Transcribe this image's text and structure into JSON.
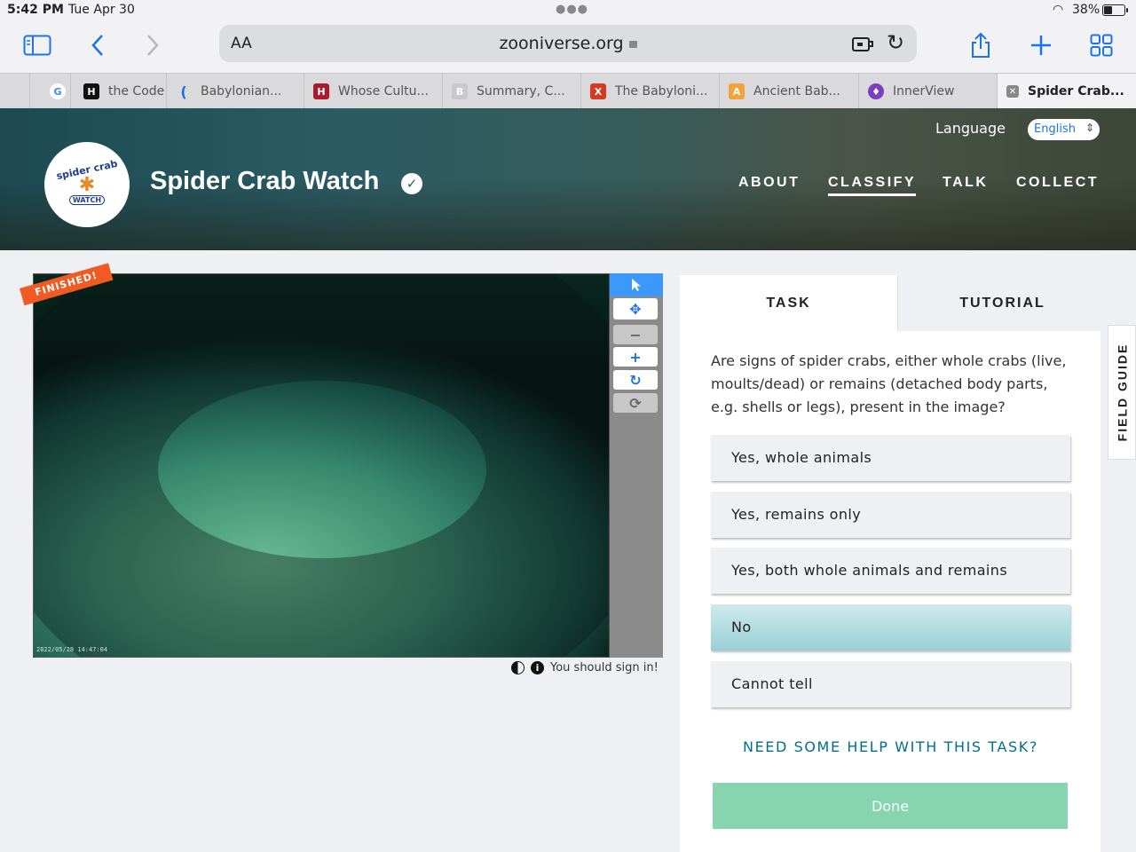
{
  "status_bar": {
    "time": "5:42 PM",
    "date": "Tue Apr 30",
    "battery_percent": "38%",
    "battery_level": 0.38
  },
  "browser": {
    "text_size_label": "AA",
    "url": "zooniverse.org",
    "tabs": [
      {
        "title": "",
        "favicon_text": "G",
        "favicon_color": "#ffffff"
      },
      {
        "title": "the Code",
        "favicon_text": "H",
        "favicon_color": "#111111"
      },
      {
        "title": "Babylonian...",
        "favicon_text": "(",
        "favicon_color": "#1e6fd9"
      },
      {
        "title": "Whose Cultu...",
        "favicon_text": "H",
        "favicon_color": "#a51c30"
      },
      {
        "title": "Summary, C...",
        "favicon_text": "B",
        "favicon_color": "#c9c9cc"
      },
      {
        "title": "The Babyloni...",
        "favicon_text": "X",
        "favicon_color": "#d63a1f"
      },
      {
        "title": "Ancient Bab...",
        "favicon_text": "A",
        "favicon_color": "#f2a33a"
      },
      {
        "title": "InnerView",
        "favicon_text": "♦",
        "favicon_color": "#7d3fc0"
      },
      {
        "title": "Spider Crab...",
        "favicon_text": "✕",
        "favicon_color": "#888888"
      }
    ]
  },
  "site": {
    "logo_top": "spider crab",
    "logo_bottom": "WATCH",
    "project_title": "Spider Crab Watch",
    "language_label": "Language",
    "language_value": "English",
    "nav": [
      "ABOUT",
      "CLASSIFY",
      "TALK",
      "COLLECT"
    ],
    "active_nav": "CLASSIFY"
  },
  "viewer": {
    "banner": "FINISHED!",
    "timestamp": "2022/05/28 14:47:04",
    "sign_in_note": "You should sign in!"
  },
  "task": {
    "tabs": [
      "TASK",
      "TUTORIAL"
    ],
    "question": "Are signs of spider crabs, either whole crabs (live, moults/dead) or remains (detached body parts, e.g. shells or legs), present in the image?",
    "answers": [
      "Yes, whole animals",
      "Yes, remains only",
      "Yes, both whole animals and remains",
      "No",
      "Cannot tell"
    ],
    "selected_answer": "No",
    "help_link": "NEED SOME HELP WITH THIS TASK?",
    "done_label": "Done"
  },
  "field_guide_label": "FIELD GUIDE",
  "colors": {
    "accent": "#1a73e8",
    "selected_answer": "#98d0d6",
    "done": "#86d5b0",
    "banner": "#f15a22"
  }
}
